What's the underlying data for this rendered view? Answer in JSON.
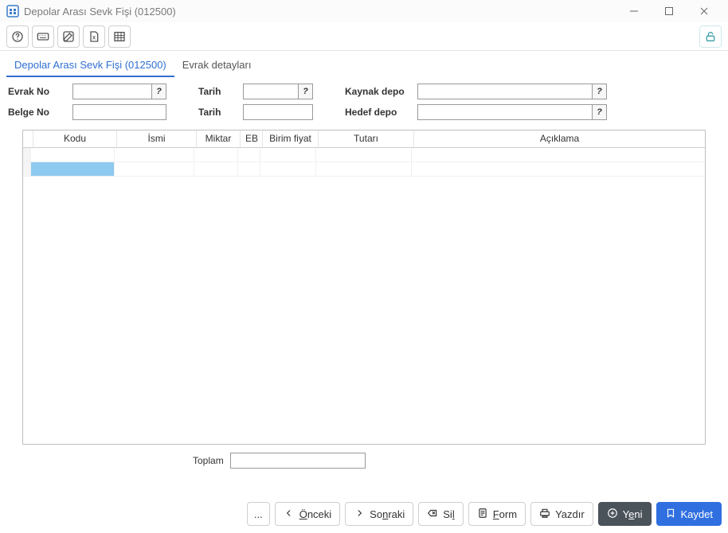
{
  "window": {
    "title": "Depolar Arası Sevk Fişi (012500)"
  },
  "toolbar": {
    "help_icon": "help",
    "keyboard_icon": "keyboard",
    "edit_icon": "edit",
    "excel_icon": "excel",
    "table_icon": "table",
    "lock_icon": "lock"
  },
  "tabs": [
    {
      "label": "Depolar Arası Sevk Fişi (012500)",
      "active": true
    },
    {
      "label": "Evrak detayları",
      "active": false
    }
  ],
  "form": {
    "left": {
      "evrak_no_label": "Evrak No",
      "evrak_no_value": "",
      "belge_no_label": "Belge No",
      "belge_no_value": ""
    },
    "center": {
      "tarih1_label": "Tarih",
      "tarih1_value": "",
      "tarih2_label": "Tarih",
      "tarih2_value": ""
    },
    "right": {
      "kaynak_label": "Kaynak depo",
      "kaynak_value": "",
      "hedef_label": "Hedef depo",
      "hedef_value": ""
    }
  },
  "grid": {
    "headers": {
      "kodu": "Kodu",
      "ismi": "İsmi",
      "miktar": "Miktar",
      "eb": "EB",
      "birim_fiyat": "Birim fiyat",
      "tutari": "Tutarı",
      "aciklama": "Açıklama"
    },
    "widths": {
      "gutter": 10,
      "kodu": 105,
      "ismi": 100,
      "miktar": 55,
      "eb": 28,
      "birim_fiyat": 70,
      "tutari": 120,
      "aciklama": 200
    }
  },
  "total": {
    "label": "Toplam",
    "value": ""
  },
  "footer": {
    "more": "...",
    "onceki": "Önceki",
    "sonraki": "Sonraki",
    "sil": "Sil",
    "form": "Form",
    "yazdir": "Yazdır",
    "yeni": "Yeni",
    "kaydet": "Kaydet"
  }
}
